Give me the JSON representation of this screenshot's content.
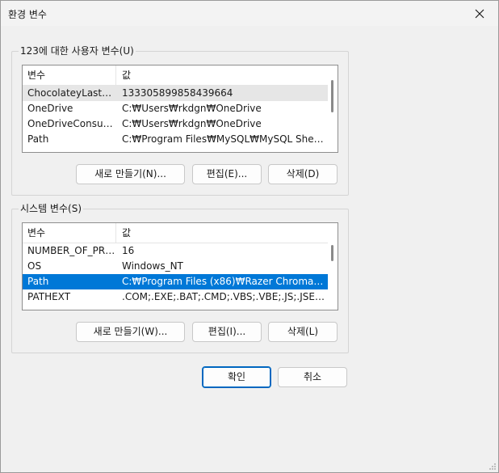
{
  "window": {
    "title": "환경 변수"
  },
  "user_vars": {
    "group_label": "123에 대한 사용자 변수(U)",
    "columns": [
      "변수",
      "값"
    ],
    "rows": [
      {
        "name": "ChocolateyLastPat...",
        "value": "133305899858439664"
      },
      {
        "name": "OneDrive",
        "value": "C:₩Users₩rkdgn₩OneDrive"
      },
      {
        "name": "OneDriveConsumer",
        "value": "C:₩Users₩rkdgn₩OneDrive"
      },
      {
        "name": "Path",
        "value": "C:₩Program Files₩MySQL₩MySQL Shell 8...."
      }
    ],
    "hover_row": 0,
    "buttons": {
      "new": "새로 만들기(N)...",
      "edit": "편집(E)...",
      "delete": "삭제(D)"
    }
  },
  "system_vars": {
    "group_label": "시스템 변수(S)",
    "columns": [
      "변수",
      "값"
    ],
    "rows": [
      {
        "name": "NUMBER_OF_PRO...",
        "value": "16"
      },
      {
        "name": "OS",
        "value": "Windows_NT"
      },
      {
        "name": "Path",
        "value": "C:₩Program Files (x86)₩Razer Chroma SD..."
      },
      {
        "name": "PATHEXT",
        "value": ".COM;.EXE;.BAT;.CMD;.VBS;.VBE;.JS;.JSE;.W..."
      }
    ],
    "selected_row": 2,
    "buttons": {
      "new": "새로 만들기(W)...",
      "edit": "편집(I)...",
      "delete": "삭제(L)"
    }
  },
  "footer": {
    "ok": "확인",
    "cancel": "취소"
  },
  "icons": {
    "close": "close-icon",
    "resize": "resize-grip-icon"
  },
  "colors": {
    "selection": "#0078d7",
    "default_button_border": "#0067c0"
  }
}
